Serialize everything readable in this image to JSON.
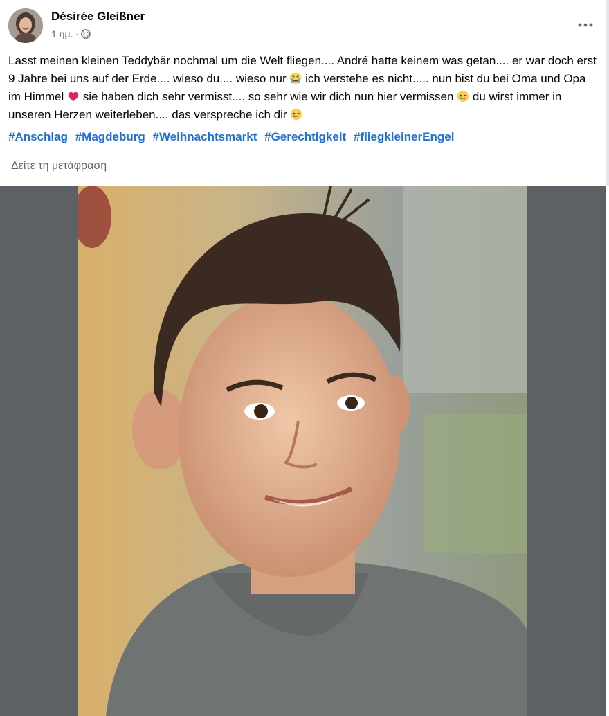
{
  "post": {
    "author_name": "Désirée Gleißner",
    "timestamp": "1 ημ.",
    "separator": "·",
    "audience_icon": "globe-icon",
    "more_icon": "more-dots-icon",
    "text_parts": [
      "Lasst meinen kleinen Teddybär nochmal um die Welt fliegen.... André hatte keinem was getan.... er war doch erst 9 Jahre bei uns auf der Erde.... wieso du.... wieso nur ",
      " ich verstehe es nicht..... nun bist du bei Oma und Opa im Himmel ",
      " sie haben dich sehr vermisst.... so sehr wie wir dich nun hier vermissen ",
      " du wirst immer in unseren Herzen weiterleben.... das verspreche ich dir "
    ],
    "emojis": [
      "crying-face-emoji",
      "red-heart-emoji",
      "sad-face-emoji",
      "sad-face-emoji"
    ],
    "hashtags": [
      "#Anschlag",
      "#Magdeburg",
      "#Weihnachtsmarkt",
      "#Gerechtigkeit",
      "#fliegkleinerEngel"
    ],
    "translate_link": "Δείτε τη μετάφραση",
    "image": "photo-of-smiling-boy"
  },
  "colors": {
    "text": "#050505",
    "secondary": "#65676b",
    "link": "#216fdb",
    "media_bg": "#5d6166",
    "heart": "#e0245e"
  }
}
